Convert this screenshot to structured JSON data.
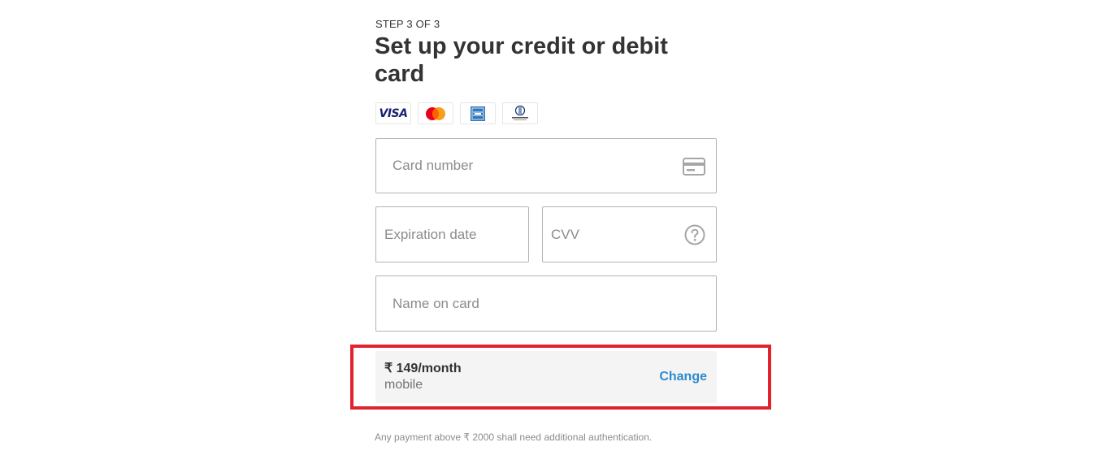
{
  "header": {
    "step": "STEP 3 OF 3",
    "title": "Set up your credit or debit card"
  },
  "card_logos": [
    {
      "name": "visa",
      "text": "VISA"
    },
    {
      "name": "mastercard"
    },
    {
      "name": "amex"
    },
    {
      "name": "diners-club"
    }
  ],
  "form": {
    "card_number": {
      "placeholder": "Card number",
      "value": "",
      "icon": "credit-card-icon"
    },
    "expiration": {
      "placeholder": "Expiration date",
      "value": ""
    },
    "cvv": {
      "placeholder": "CVV",
      "value": "",
      "icon": "help-circle-icon"
    },
    "name": {
      "placeholder": "Name on card",
      "value": ""
    }
  },
  "plan": {
    "price": "₹ 149/month",
    "name": "mobile",
    "change_label": "Change"
  },
  "footer": {
    "note": "Any payment above ₹ 2000 shall need additional authentication."
  },
  "colors": {
    "highlight": "#e0242d",
    "link": "#2e8bcc",
    "plan_bg": "#f4f4f4"
  }
}
